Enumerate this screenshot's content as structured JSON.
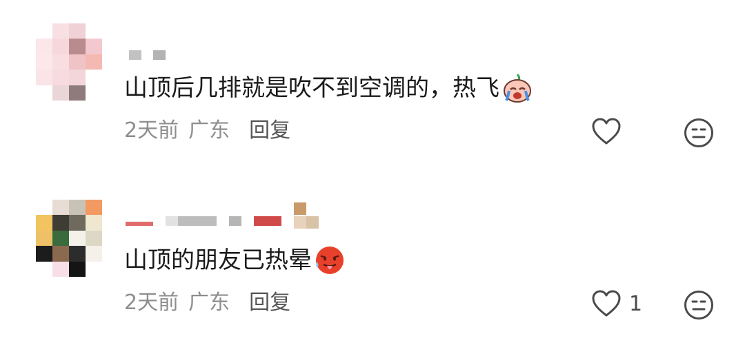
{
  "comments": [
    {
      "text": "山顶后几排就是吹不到空调的，热飞",
      "emoji": "crying-face-emoji",
      "time": "2天前",
      "location": "广东",
      "reply_label": "回复",
      "like_count": ""
    },
    {
      "text": "山顶的朋友已热晕",
      "emoji": "hot-face-emoji",
      "time": "2天前",
      "location": "广东",
      "reply_label": "回复",
      "like_count": "1"
    }
  ],
  "colors": {
    "text": "#1b1b1b",
    "meta": "#8e8e8e",
    "icon": "#4a4a4a"
  }
}
